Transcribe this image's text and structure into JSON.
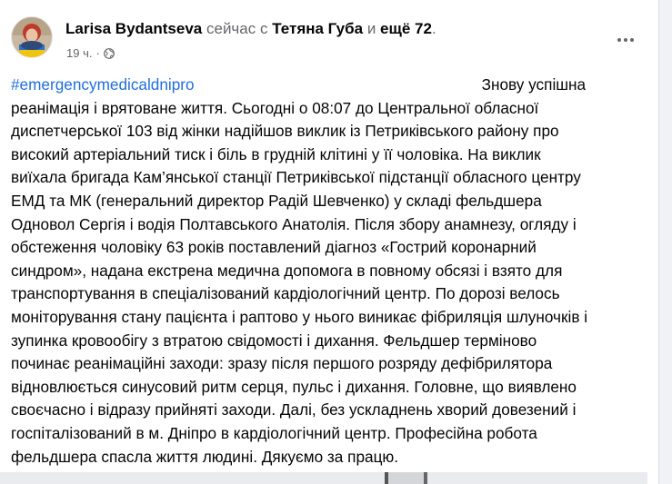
{
  "post": {
    "author": "Larisa Bydantseva",
    "status_text": "сейчас с",
    "tagged": "Тетяна Губа",
    "and_text": "и",
    "others": "ещё 72",
    "period": ".",
    "time": "19 ч.",
    "separator": "·",
    "hashtag": "#emergencymedicaldnipro",
    "lines": [
      "Знову успішна",
      "реанімація і  врятоване життя. Сьогодні  о 08:07 до Центральної обласної",
      "диспетчерської 103 від жінки надійшов виклик із Петриківського району про",
      "високий артеріальний тиск і біль в грудній клітині у її чоловіка. На виклик",
      "виїхала бригада Кам’янської станції Петриківської  підстанції  обласного центру",
      "ЕМД та МК (генеральний директор Радій Шевченко) у складі фельдшера",
      "Одновол Сергія і водія Полтавського Анатолія. Після збору анамнезу, огляду і",
      "обстеження чоловіку 63 років поставлений діагноз «Гострий коронарний",
      "синдром», надана екстрена медична допомога в повному обсязі і взято для",
      "транспортування в спеціалізований кардіологічний центр. По дорозі велось",
      "моніторування стану пацієнта і раптово у нього виникає фібриляція шлуночків і",
      "зупинка кровообігу з втратою свідомості і дихання. Фельдшер терміново",
      "починає реанімаційні заходи: зразу після першого розряду дефібрилятора",
      "відновлюється синусовий ритм серця, пульс і дихання. Головне, що виявлено",
      "своєчасно і відразу прийняті заходи. Далі, без ускладнень хворий довезений і",
      "госпіталізований в м. Дніпро в кардіологічний центр. Професійна робота",
      "фельдшера спасла життя людині. Дякуємо за працю."
    ]
  },
  "icons": {
    "globe": "globe-icon",
    "more": "more-options-icon"
  },
  "colors": {
    "link": "#216fdb",
    "secondary_text": "#65676b",
    "primary_text": "#050505"
  }
}
